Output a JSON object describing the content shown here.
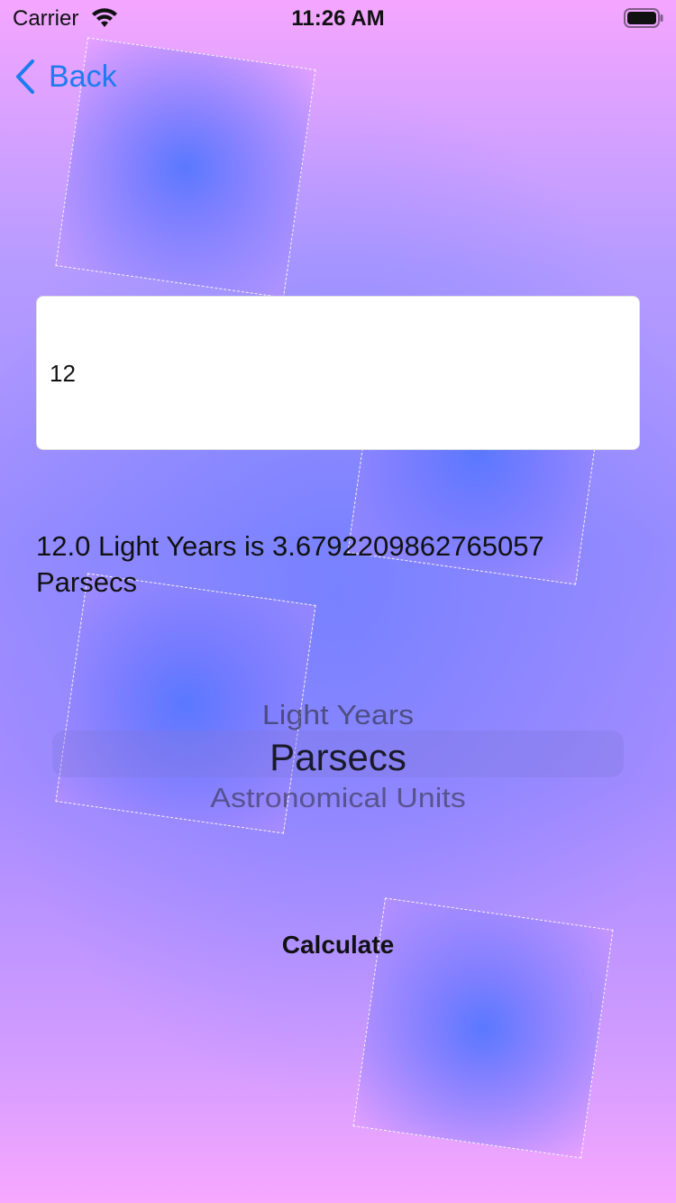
{
  "status_bar": {
    "carrier": "Carrier",
    "time": "11:26 AM"
  },
  "nav": {
    "back_label": "Back",
    "accent_color": "#1e7bf0"
  },
  "converter": {
    "input_value": "12",
    "result_text": "12.0 Light Years is 3.6792209862765057 Parsecs"
  },
  "unit_picker": {
    "above": "Light Years",
    "selected": "Parsecs",
    "below": "Astronomical Units"
  },
  "calculate_label": "Calculate"
}
